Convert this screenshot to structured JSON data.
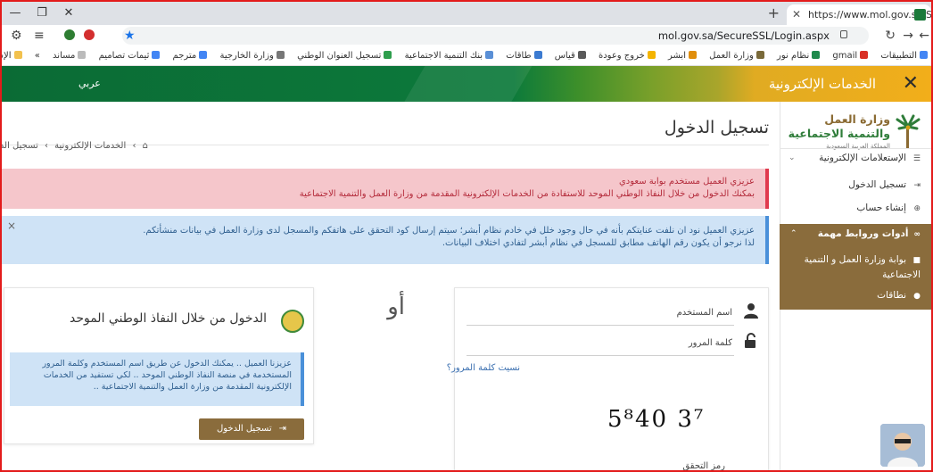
{
  "browser": {
    "tab_title": "https://www.mol.gov.sa/SecureS",
    "url": "mol.gov.sa/SecureSSL/Login.aspx",
    "new_tab": "+",
    "bookmarks": [
      "التطبيقات",
      "gmail",
      "نظام نور",
      "وزارة العمل",
      "ابشر",
      "خروج وعودة",
      "قياس",
      "طاقات",
      "بنك التنمية الاجتماعية",
      "تسجيل العنوان الوطني",
      "وزارة الخارجية",
      "مترجم",
      "ثيمات تصاميم",
      "مساند"
    ],
    "bookmarks_overflow": "»",
    "bookmarks_other": "الإشارات الأخرى"
  },
  "banner": {
    "title": "الخدمات الإلكترونية",
    "lang": "عربي"
  },
  "sidebar": {
    "logo_line1": "وزارة العمل",
    "logo_line2": "والتنمية الاجتماعية",
    "logo_line3": "المملكة العربية السعودية",
    "section_inquiries": "الإستعلامات الإلكترونية",
    "items": [
      "تسجيل الدخول",
      "إنشاء حساب"
    ],
    "tools_header": "أدوات وروابط مهمة",
    "tools_items": [
      "بوابة وزارة العمل و التنمية الاجتماعية",
      "نطاقات"
    ]
  },
  "main": {
    "page_title": "تسجيل الدخول",
    "breadcrumb": [
      "الخدمات الإلكترونية",
      "تسجيل الدخ"
    ],
    "alert_red": {
      "line1": "عزيزي العميل مستخدم بوابة سعودي",
      "line2": "بمكنك الدخول من خلال النفاذ الوطني الموحد للاستفادة من الخدمات الإلكترونية المقدمة من وزارة العمل والتنمية الاجتماعية"
    },
    "alert_blue": {
      "line1": "عزيزي العميل نود ان نلفت عنايتكم بأنه في حال وجود خلل في خادم نظام أبشر؛ سيتم إرسال كود التحقق على هاتفكم والمسجل لدى وزارة العمل في بيانات منشأتكم.",
      "line2": "لذا نرجو أن يكون رقم الهاتف مطابق للمسجل في نظام أبشر لتفادي اختلاف البيانات."
    },
    "login": {
      "username_label": "اسم المستخدم",
      "password_label": "كلمة المرور",
      "forgot_link": "نسيت كلمة المرور؟",
      "captcha_text": "5⁸40 3⁷",
      "verify_label": "رمز التحقق"
    },
    "or_label": "أو",
    "nafath": {
      "title": "الدخول من خلال النفاذ الوطني الموحد",
      "info": "عزيزنا العميل .. يمكنك الدخول عن طريق اسم المستخدم وكلمة المرور المستخدمة في منصة النفاذ الوطني الموحد .. لكي تستفيد من الخدمات الإلكترونية المقدمة من وزارة العمل والتنمية الاجتماعية ..",
      "button": "تسجيل الدخول"
    }
  }
}
